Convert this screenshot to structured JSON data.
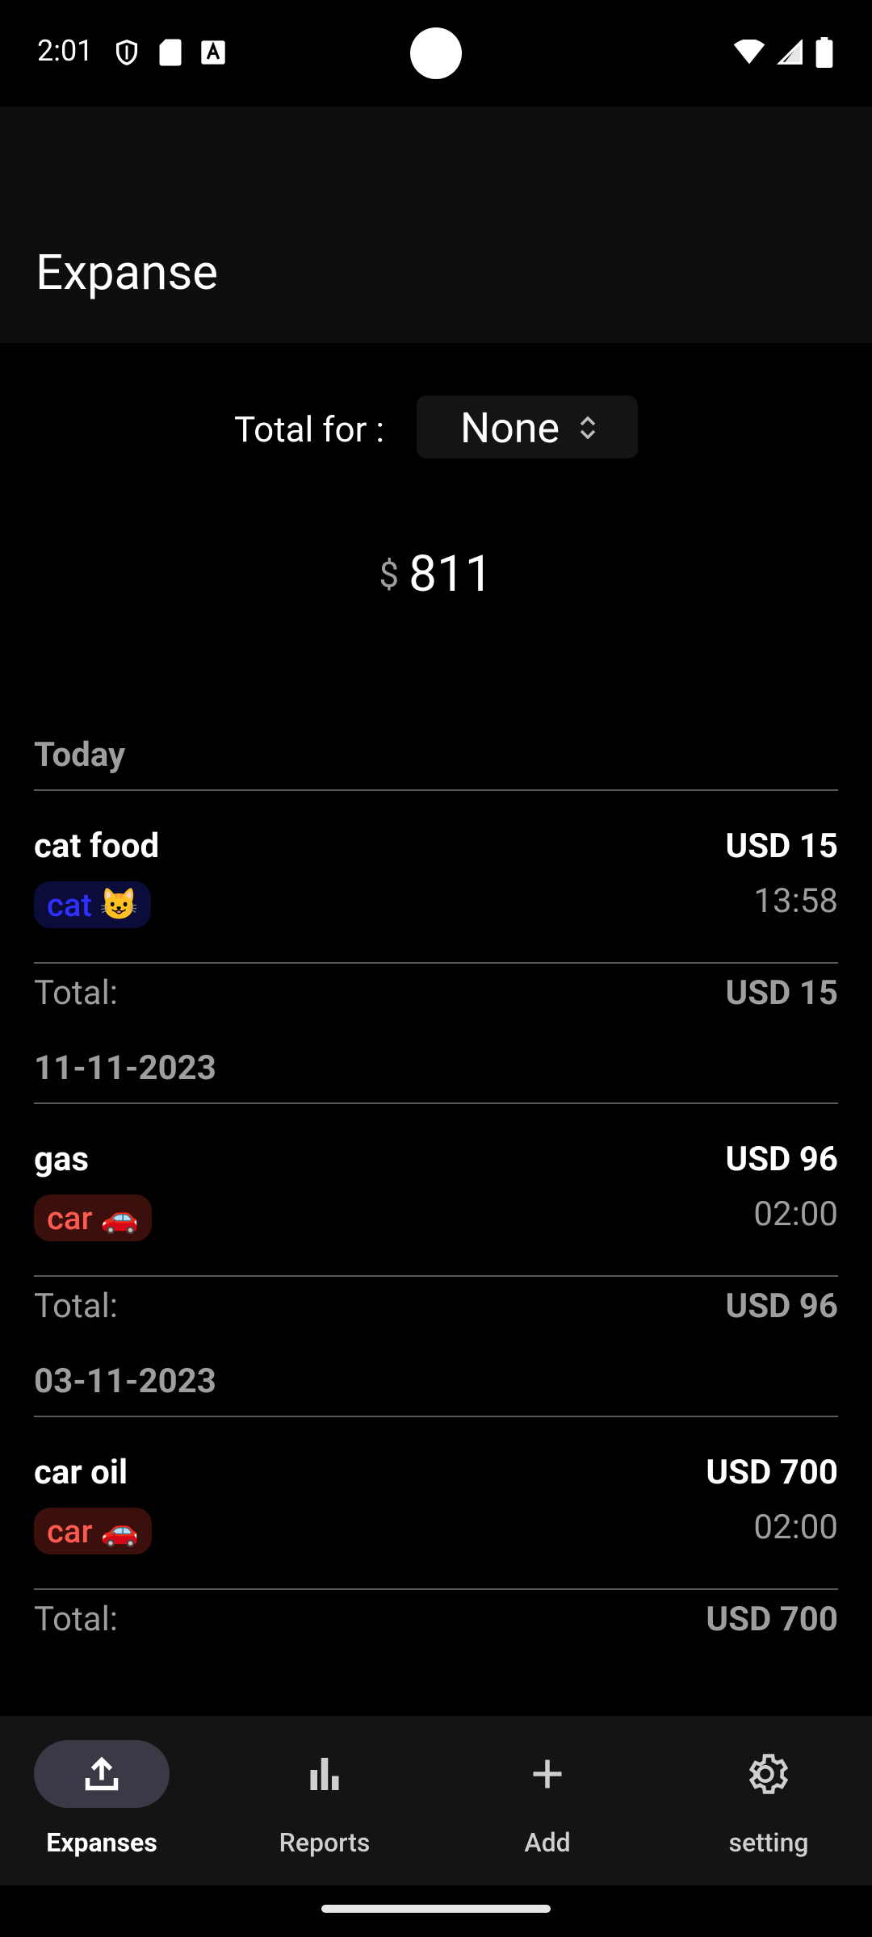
{
  "status": {
    "time": "2:01"
  },
  "app": {
    "title": "Expanse"
  },
  "totals": {
    "label": "Total for :",
    "filter_value": "None",
    "currency_symbol": "$",
    "amount": "811"
  },
  "groups": [
    {
      "date": "Today",
      "items": [
        {
          "name": "cat food",
          "amount": "USD 15",
          "time": "13:58",
          "tag": "cat",
          "tag_emoji": "😺"
        }
      ],
      "total_label": "Total:",
      "total_amount": "USD 15"
    },
    {
      "date": "11-11-2023",
      "items": [
        {
          "name": "gas",
          "amount": "USD 96",
          "time": "02:00",
          "tag": "car",
          "tag_emoji": "🚗"
        }
      ],
      "total_label": "Total:",
      "total_amount": "USD 96"
    },
    {
      "date": "03-11-2023",
      "items": [
        {
          "name": "car oil",
          "amount": "USD 700",
          "time": "02:00",
          "tag": "car",
          "tag_emoji": "🚗"
        }
      ],
      "total_label": "Total:",
      "total_amount": "USD 700"
    }
  ],
  "nav": {
    "items": [
      {
        "label": "Expanses",
        "icon": "upload-icon",
        "active": true
      },
      {
        "label": "Reports",
        "icon": "bar-chart-icon",
        "active": false
      },
      {
        "label": "Add",
        "icon": "plus-icon",
        "active": false
      },
      {
        "label": "setting",
        "icon": "gear-icon",
        "active": false
      }
    ]
  },
  "colors": {
    "cat_tag_bg": "#0b0c3a",
    "cat_tag_fg": "#2f2fff",
    "car_tag_bg": "#3a0f0c",
    "car_tag_fg": "#ff5a4f",
    "nav_active_pill": "#3a3945"
  }
}
